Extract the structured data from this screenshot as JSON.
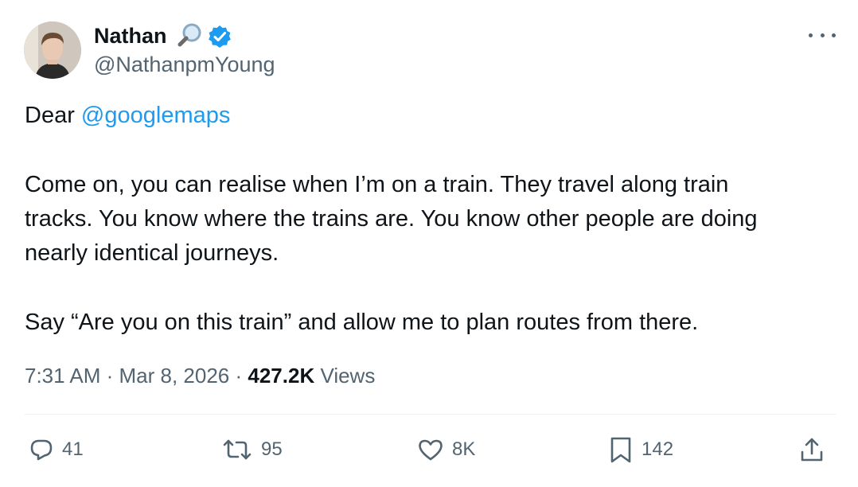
{
  "author": {
    "name": "Nathan",
    "handle": "@NathanpmYoung",
    "name_emoji": "magnifying-glass-icon",
    "verified_badge": "verified-badge-icon"
  },
  "tweet": {
    "greeting": "Dear ",
    "mention": "@googlemaps",
    "line2": "Come on, you can realise when I’m on a train. They travel along train",
    "line3": "tracks. You know where the trains are. You know other people are doing",
    "line4": "nearly identical journeys.",
    "line5": "Say “Are you on this train” and allow me to plan routes from there."
  },
  "meta": {
    "time": "7:31 AM",
    "separator": " · ",
    "date": "Mar 8, 2026",
    "views_count": "427.2K",
    "views_label": " Views"
  },
  "actions": {
    "replies": "41",
    "reposts": "95",
    "likes": "8K",
    "bookmarks": "142"
  },
  "colors": {
    "accent": "#1d9bf0",
    "text": "#0f1419",
    "secondary": "#536471",
    "divider": "#eff3f4"
  }
}
